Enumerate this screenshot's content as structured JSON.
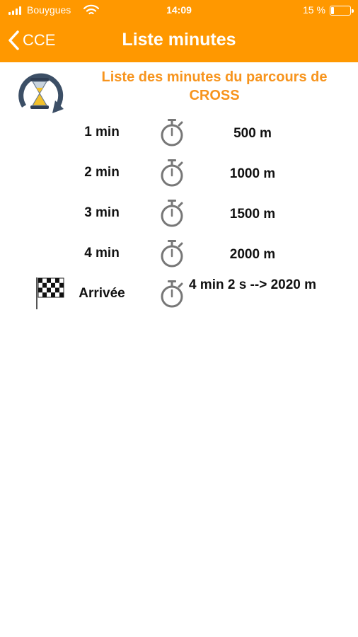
{
  "status_bar": {
    "carrier": "Bouygues",
    "time": "14:09",
    "battery": "15 %",
    "battery_level": 0.15
  },
  "nav": {
    "back_label": "CCE",
    "title": "Liste minutes"
  },
  "subtitle": "Liste des minutes du parcours de CROSS",
  "colors": {
    "header": "#FF9800",
    "subtitle": "#F7941D"
  },
  "rows": [
    {
      "label": "1 min",
      "value": "500 m",
      "icon": "stopwatch-icon"
    },
    {
      "label": "2 min",
      "value": "1000 m",
      "icon": "stopwatch-icon"
    },
    {
      "label": "3 min",
      "value": "1500 m",
      "icon": "stopwatch-icon"
    },
    {
      "label": "4 min",
      "value": "2000 m",
      "icon": "stopwatch-icon"
    },
    {
      "label": "Arrivée",
      "value": "4 min 2 s --> 2020 m",
      "icon": "stopwatch-icon",
      "flag_icon": "checkered-flag-icon"
    }
  ]
}
